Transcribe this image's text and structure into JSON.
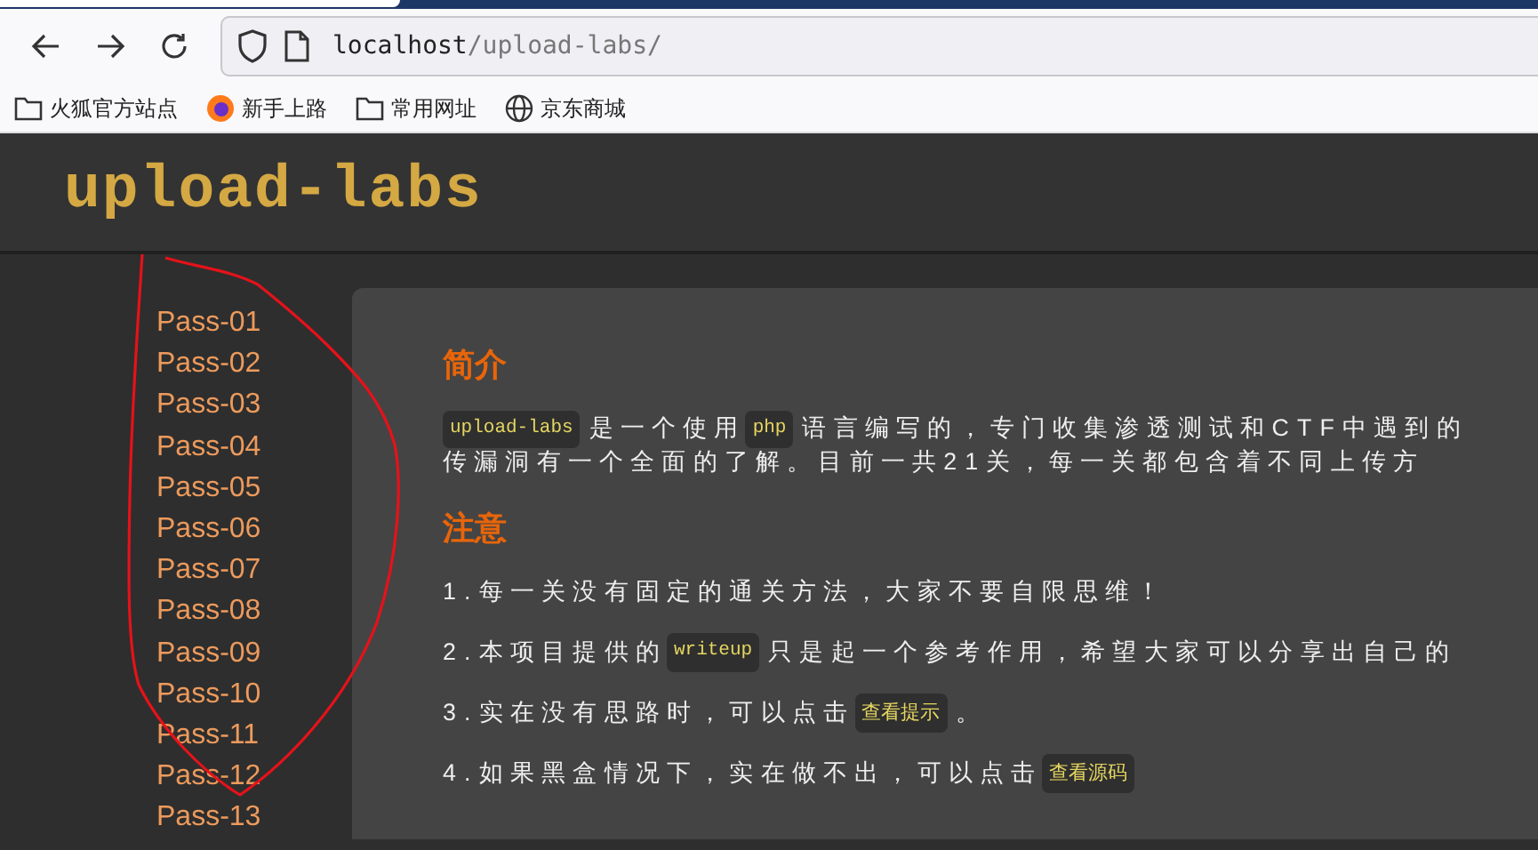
{
  "browser": {
    "url_host": "localhost",
    "url_path": "/upload-labs/",
    "bookmarks": [
      {
        "kind": "folder",
        "label": "火狐官方站点"
      },
      {
        "kind": "firefox",
        "label": "新手上路"
      },
      {
        "kind": "folder",
        "label": "常用网址"
      },
      {
        "kind": "globe",
        "label": "京东商城"
      }
    ]
  },
  "header": {
    "logo": "upload-labs"
  },
  "sidebar": {
    "items": [
      "Pass-01",
      "Pass-02",
      "Pass-03",
      "Pass-04",
      "Pass-05",
      "Pass-06",
      "Pass-07",
      "Pass-08",
      "Pass-09",
      "Pass-10",
      "Pass-11",
      "Pass-12",
      "Pass-13"
    ]
  },
  "sections": [
    {
      "heading": "简介",
      "kind": "paragraph",
      "lines": [
        [
          {
            "kind": "code",
            "text": "upload-labs"
          },
          {
            "kind": "text",
            "text": "是一个使用"
          },
          {
            "kind": "code",
            "text": "php"
          },
          {
            "kind": "text",
            "text": "语言编写的，专门收集渗透测试和CTF中遇到的"
          }
        ],
        [
          {
            "kind": "text",
            "text": "传漏洞有一个全面的了解。目前一共21关，每一关都包含着不同上传方"
          }
        ]
      ]
    },
    {
      "heading": "注意",
      "kind": "list",
      "lines": [
        [
          {
            "kind": "text",
            "text": "1.每一关没有固定的通关方法，大家不要自限思维！"
          }
        ],
        [
          {
            "kind": "text",
            "text": "2.本项目提供的"
          },
          {
            "kind": "code",
            "text": "writeup"
          },
          {
            "kind": "text",
            "text": "只是起一个参考作用，希望大家可以分享出自己的"
          }
        ],
        [
          {
            "kind": "text",
            "text": "3.实在没有思路时，可以点击"
          },
          {
            "kind": "link",
            "text": "查看提示"
          },
          {
            "kind": "text",
            "text": "。"
          }
        ],
        [
          {
            "kind": "text",
            "text": "4.如果黑盒情况下，实在做不出，可以点击"
          },
          {
            "kind": "link",
            "text": "查看源码"
          }
        ]
      ]
    }
  ]
}
